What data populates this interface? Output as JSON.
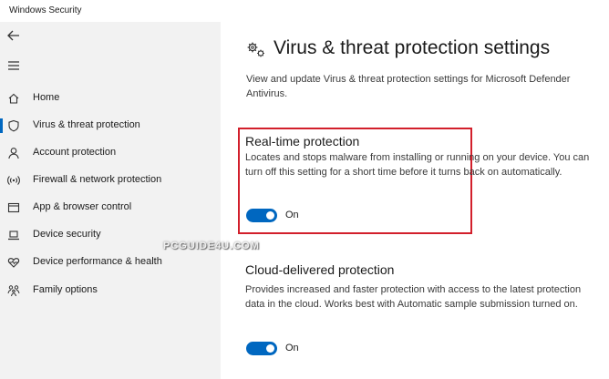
{
  "window": {
    "title": "Windows Security"
  },
  "sidebar": {
    "items": [
      {
        "label": "Home",
        "icon": "home-icon"
      },
      {
        "label": "Virus & threat protection",
        "icon": "shield-icon",
        "active": true
      },
      {
        "label": "Account protection",
        "icon": "person-icon"
      },
      {
        "label": "Firewall & network protection",
        "icon": "wifi-icon"
      },
      {
        "label": "App & browser control",
        "icon": "app-window-icon"
      },
      {
        "label": "Device security",
        "icon": "laptop-icon"
      },
      {
        "label": "Device performance & health",
        "icon": "heart-icon"
      },
      {
        "label": "Family options",
        "icon": "family-icon"
      }
    ]
  },
  "main": {
    "title": "Virus & threat protection settings",
    "description": "View and update Virus & threat protection settings for Microsoft Defender Antivirus.",
    "sections": [
      {
        "title": "Real-time protection",
        "description": "Locates and stops malware from installing or running on your device. You can turn off this setting for a short time before it turns back on automatically.",
        "toggle_state": "On"
      },
      {
        "title": "Cloud-delivered protection",
        "description": "Provides increased and faster protection with access to the latest protection data in the cloud. Works best with Automatic sample submission turned on.",
        "toggle_state": "On"
      }
    ]
  },
  "watermark": "PCGUIDE4U.COM",
  "colors": {
    "accent": "#0067c0",
    "highlight": "#d21f2b",
    "sidebar_bg": "#f2f2f2"
  }
}
